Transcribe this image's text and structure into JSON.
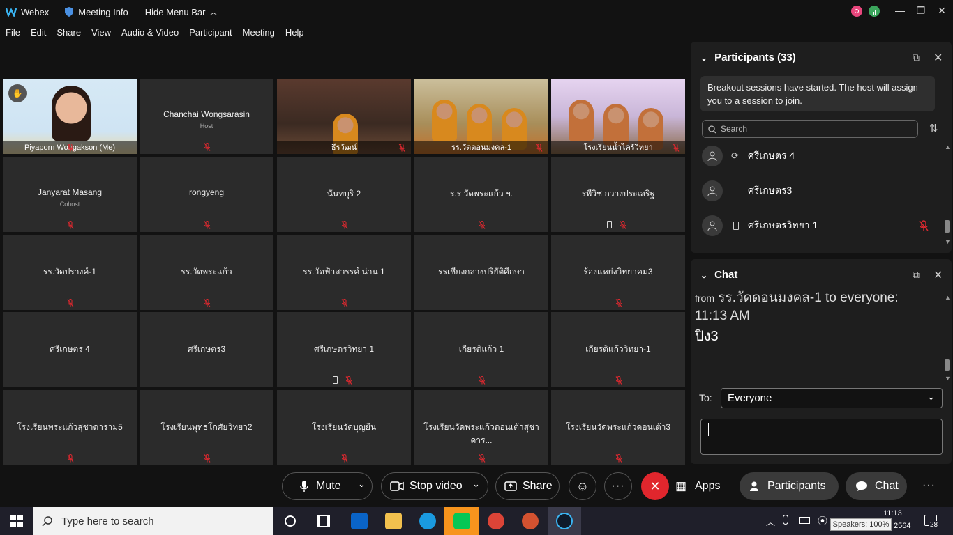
{
  "titlebar": {
    "app": "Webex",
    "meeting_info": "Meeting Info",
    "hide_menu": "Hide Menu Bar"
  },
  "menu": [
    "File",
    "Edit",
    "Share",
    "View",
    "Audio & Video",
    "Participant",
    "Meeting",
    "Help"
  ],
  "tiles": [
    {
      "name": "Piyaporn Wongakson  (Me)",
      "role": "",
      "video": true,
      "mic": "mic-off"
    },
    {
      "name": "Chanchai Wongsarasin",
      "role": "Host",
      "video": false,
      "mic": "mic-off"
    },
    {
      "name": "ธีรวัฒน์",
      "role": "",
      "video": true,
      "mic": "mic-off"
    },
    {
      "name": "รร.วัดดอนมงคล-1",
      "role": "",
      "video": true,
      "mic": "mic-off"
    },
    {
      "name": "โรงเรียนน้ำไคร้วิทยา",
      "role": "",
      "video": true,
      "mic": "mic-off"
    },
    {
      "name": "Janyarat Masang",
      "role": "Cohost",
      "video": false,
      "mic": "mic-off"
    },
    {
      "name": "rongyeng",
      "role": "",
      "video": false,
      "mic": "mic-off"
    },
    {
      "name": "นันทบุริ 2",
      "role": "",
      "video": false,
      "mic": "mic-off"
    },
    {
      "name": "ร.ร วัดพระแก้ว ฯ.",
      "role": "",
      "video": false,
      "mic": "mic-off"
    },
    {
      "name": "รพีวิช กวางประเสริฐ",
      "role": "",
      "video": false,
      "mic": "mic-off",
      "phone": true
    },
    {
      "name": "รร.วัดปรางค์-1",
      "role": "",
      "video": false,
      "mic": "mic-off"
    },
    {
      "name": "รร.วัดพระแก้ว",
      "role": "",
      "video": false,
      "mic": "mic-off"
    },
    {
      "name": "รร.วัดฟ้าสวรรค์ น่าน 1",
      "role": "",
      "video": false,
      "mic": "mic-off"
    },
    {
      "name": "รรเชียงกลางปริยัติศึกษา",
      "role": "",
      "video": false,
      "mic": ""
    },
    {
      "name": "ร้องแหย่งวิทยาคม3",
      "role": "",
      "video": false,
      "mic": "mic-off"
    },
    {
      "name": "ศรีเกษตร 4",
      "role": "",
      "video": false,
      "mic": ""
    },
    {
      "name": "ศรีเกษตร3",
      "role": "",
      "video": false,
      "mic": ""
    },
    {
      "name": "ศรีเกษตรวิทยา 1",
      "role": "",
      "video": false,
      "mic": "mic-off",
      "phone": true
    },
    {
      "name": "เกียรติแก้ว 1",
      "role": "",
      "video": false,
      "mic": "mic-off"
    },
    {
      "name": "เกียรติแก้ววิทยา-1",
      "role": "",
      "video": false,
      "mic": "mic-off"
    },
    {
      "name": "โรงเรียนพระแก้วสุชาดาราม5",
      "role": "",
      "video": false,
      "mic": "mic-off"
    },
    {
      "name": "โรงเรียนพุทธโกศัยวิทยา2",
      "role": "",
      "video": false,
      "mic": "mic-off"
    },
    {
      "name": "โรงเรียนวัดบุญยืน",
      "role": "",
      "video": false,
      "mic": "mic-off"
    },
    {
      "name": "โรงเรียนวัดพระแก้วดอนเต้าสุชาดาร...",
      "role": "",
      "video": false,
      "mic": "mic-off"
    },
    {
      "name": "โรงเรียนวัดพระแก้วดอนเต้า3",
      "role": "",
      "video": false,
      "mic": "mic-off"
    }
  ],
  "participants_panel": {
    "title": "Participants (33)",
    "notice": "Breakout sessions have started. The host will assign you to a session to join.",
    "search_placeholder": "Search",
    "rows": [
      {
        "name": "ศรีเกษตร 4",
        "device": "rejoin-icon",
        "muted": false
      },
      {
        "name": "ศรีเกษตร3",
        "device": "",
        "muted": false
      },
      {
        "name": "ศรีเกษตรวิทยา 1",
        "device": "phone-icon",
        "muted": true
      }
    ]
  },
  "chat_panel": {
    "title": "Chat",
    "from_label": "from",
    "sender_line": "รร.วัดดอนมงคล-1 to everyone:",
    "time": "11:13 AM",
    "message": "ปิง3",
    "to_label": "To:",
    "to_value": "Everyone"
  },
  "toolbar": {
    "mute": "Mute",
    "stop_video": "Stop video",
    "share": "Share",
    "apps": "Apps",
    "participants": "Participants",
    "chat": "Chat"
  },
  "taskbar": {
    "search_placeholder": "Type here to search",
    "time": "11:13",
    "date_partial": "2564",
    "speaker_tooltip": "Speakers: 100%",
    "notif_count": "28"
  },
  "colors": {
    "end_call": "#e0262d",
    "mic_off": "#d9282f",
    "panel": "#1e1e1e",
    "stage_tile": "#2b2b2b"
  }
}
